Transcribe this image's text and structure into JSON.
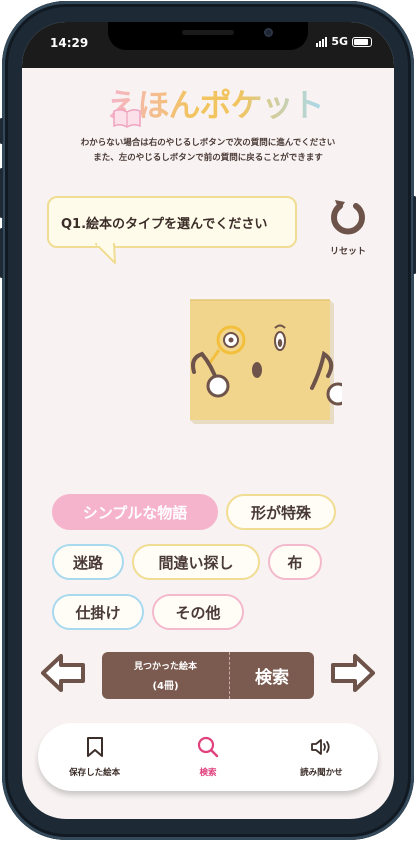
{
  "status_bar": {
    "time": "14:29",
    "network": "5G"
  },
  "app": {
    "logo_text": "えほんポケット",
    "instructions": [
      "わからない場合は右のやじるしボタンで次の質問に進んでください",
      "また、左のやじるしボタンで前の質問に戻ることができます"
    ]
  },
  "question": {
    "text": "Q1.絵本のタイプを選んでください"
  },
  "reset": {
    "label": "リセット",
    "icon": "refresh-icon"
  },
  "options": [
    {
      "label": "シンプルな物語",
      "selected": true,
      "color": "#f6b4cc"
    },
    {
      "label": "形が特殊",
      "selected": false,
      "color": "#f0dc93"
    },
    {
      "label": "迷路",
      "selected": false,
      "color": "#a8d9ef"
    },
    {
      "label": "間違い探し",
      "selected": false,
      "color": "#f0dc93"
    },
    {
      "label": "布",
      "selected": false,
      "color": "#f4b9cc"
    },
    {
      "label": "仕掛け",
      "selected": false,
      "color": "#a8d9ef"
    },
    {
      "label": "その他",
      "selected": false,
      "color": "#f4b9cc"
    }
  ],
  "result": {
    "found_label": "見つかった絵本",
    "found_count": "(4冊)",
    "search_label": "検索"
  },
  "tabs": [
    {
      "label": "保存した絵本",
      "icon": "bookmark-icon",
      "active": false
    },
    {
      "label": "検索",
      "icon": "search-icon",
      "active": true
    },
    {
      "label": "読み聞かせ",
      "icon": "speaker-icon",
      "active": false
    }
  ],
  "colors": {
    "background": "#f8f3f2",
    "accent_pink": "#f6b4cc",
    "brown": "#7b5b50",
    "active_tab": "#e0407c",
    "mascot_yellow": "#f2d58c"
  }
}
